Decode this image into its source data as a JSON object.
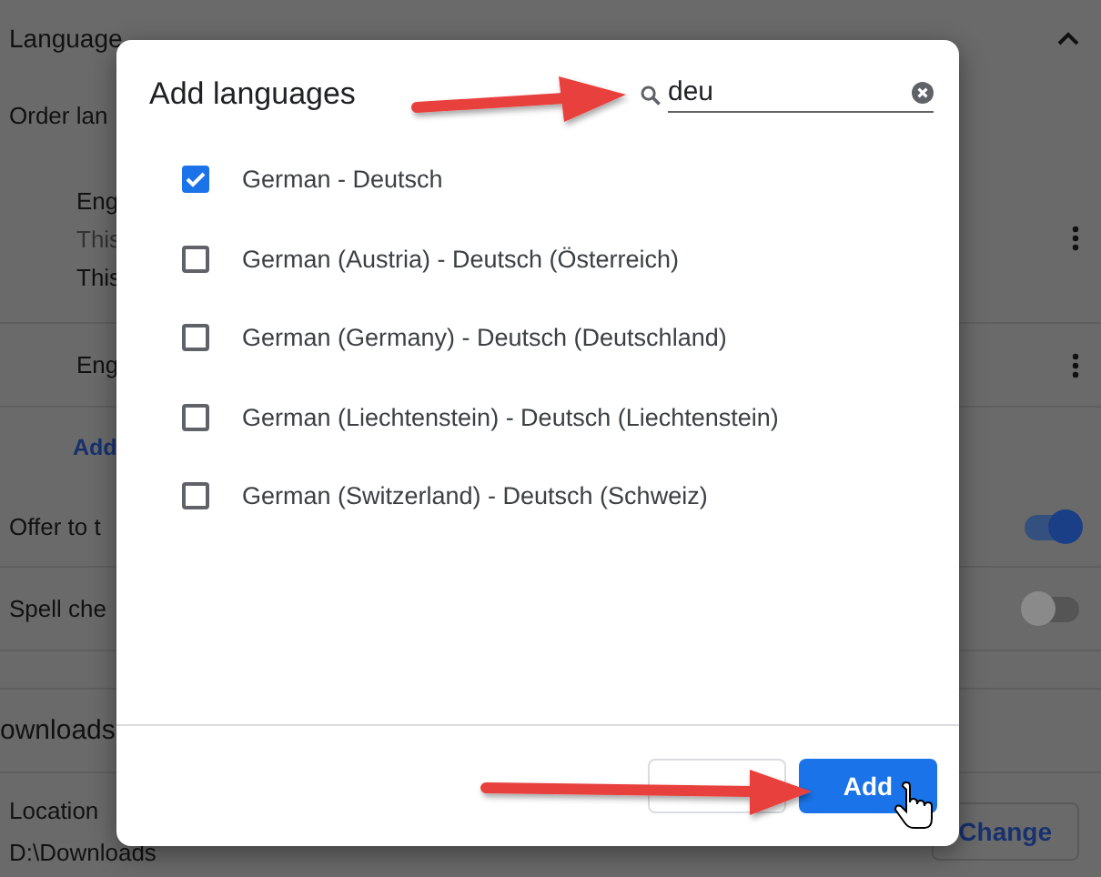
{
  "background": {
    "section_title": "Language",
    "subtitle": "Order lan",
    "languages": [
      {
        "name": "Eng",
        "lines": [
          "This",
          "This"
        ]
      },
      {
        "name": "Eng"
      }
    ],
    "add_link": "Add",
    "toggles": [
      {
        "label": "Offer to t",
        "on": true
      },
      {
        "label": "Spell che",
        "on": false
      }
    ],
    "downloads": {
      "title": "ownloads",
      "location_label": "Location",
      "location_value": "D:\\Downloads",
      "change_button": "Change"
    }
  },
  "dialog": {
    "title": "Add languages",
    "search": {
      "value": "deu"
    },
    "items": [
      {
        "label": "German - Deutsch",
        "checked": true
      },
      {
        "label": "German (Austria) - Deutsch (Österreich)",
        "checked": false
      },
      {
        "label": "German (Germany) - Deutsch (Deutschland)",
        "checked": false
      },
      {
        "label": "German (Liechtenstein) - Deutsch (Liechtenstein)",
        "checked": false
      },
      {
        "label": "German (Switzerland) - Deutsch (Schweiz)",
        "checked": false
      }
    ],
    "buttons": [
      {
        "kind": "secondary"
      },
      {
        "label": "Add",
        "kind": "primary"
      }
    ]
  }
}
